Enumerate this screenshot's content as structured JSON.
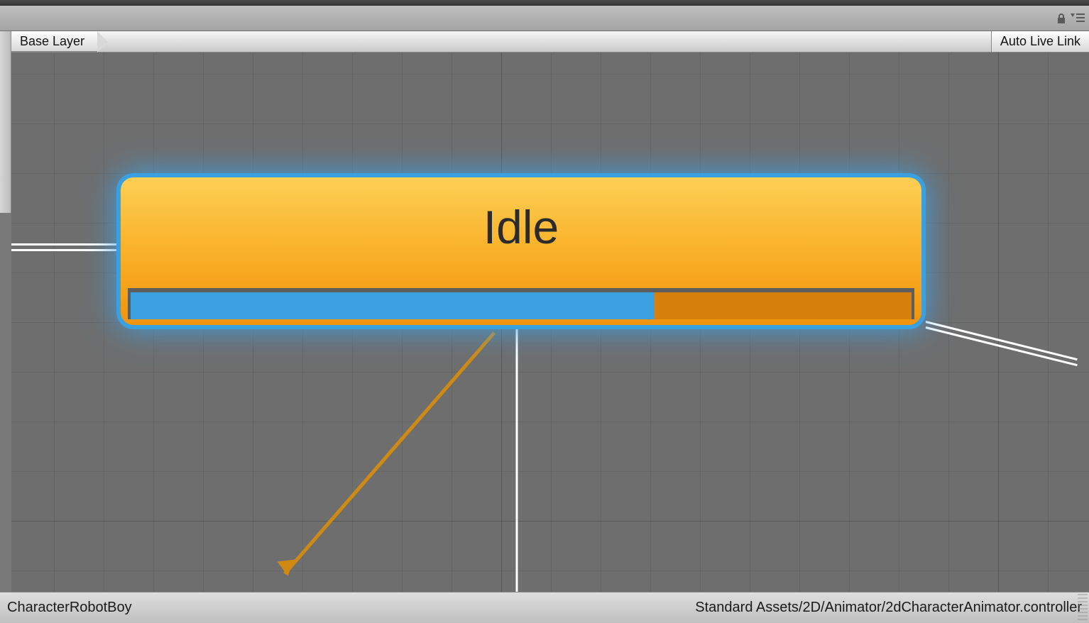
{
  "toolbar": {
    "lock_icon": "lock",
    "menu_icon": "menu"
  },
  "breadcrumb": {
    "layer_label": "Base Layer"
  },
  "header": {
    "auto_live_link_label": "Auto Live Link"
  },
  "graph": {
    "state": {
      "name": "Idle",
      "progress_percent": 67
    }
  },
  "status": {
    "left_label": "CharacterRobotBoy",
    "right_label": "Standard Assets/2D/Animator/2dCharacterAnimator.controller"
  }
}
